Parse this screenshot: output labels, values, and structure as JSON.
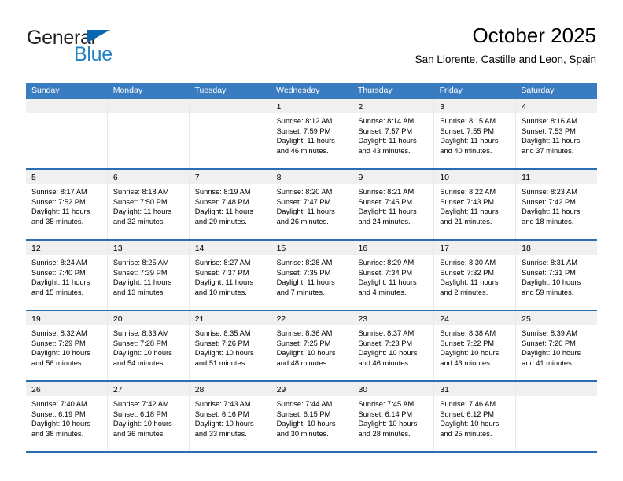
{
  "brand": {
    "name_dark": "General",
    "name_blue": "Blue",
    "color_dark": "#231f20",
    "color_blue": "#2081c8",
    "triangle_color": "#0b66b1"
  },
  "header": {
    "title": "October 2025",
    "subtitle": "San Llorente, Castille and Leon, Spain"
  },
  "theme": {
    "header_row_bg": "#3a7cc0",
    "week_separator": "#2c6cb0",
    "daynum_bg": "#f0f0f0",
    "text": "#000000"
  },
  "calendar": {
    "weekdays": [
      "Sunday",
      "Monday",
      "Tuesday",
      "Wednesday",
      "Thursday",
      "Friday",
      "Saturday"
    ],
    "weeks": [
      [
        {
          "day": "",
          "empty": true
        },
        {
          "day": "",
          "empty": true
        },
        {
          "day": "",
          "empty": true
        },
        {
          "day": "1",
          "sunrise": "Sunrise: 8:12 AM",
          "sunset": "Sunset: 7:59 PM",
          "daylight1": "Daylight: 11 hours",
          "daylight2": "and 46 minutes."
        },
        {
          "day": "2",
          "sunrise": "Sunrise: 8:14 AM",
          "sunset": "Sunset: 7:57 PM",
          "daylight1": "Daylight: 11 hours",
          "daylight2": "and 43 minutes."
        },
        {
          "day": "3",
          "sunrise": "Sunrise: 8:15 AM",
          "sunset": "Sunset: 7:55 PM",
          "daylight1": "Daylight: 11 hours",
          "daylight2": "and 40 minutes."
        },
        {
          "day": "4",
          "sunrise": "Sunrise: 8:16 AM",
          "sunset": "Sunset: 7:53 PM",
          "daylight1": "Daylight: 11 hours",
          "daylight2": "and 37 minutes."
        }
      ],
      [
        {
          "day": "5",
          "sunrise": "Sunrise: 8:17 AM",
          "sunset": "Sunset: 7:52 PM",
          "daylight1": "Daylight: 11 hours",
          "daylight2": "and 35 minutes."
        },
        {
          "day": "6",
          "sunrise": "Sunrise: 8:18 AM",
          "sunset": "Sunset: 7:50 PM",
          "daylight1": "Daylight: 11 hours",
          "daylight2": "and 32 minutes."
        },
        {
          "day": "7",
          "sunrise": "Sunrise: 8:19 AM",
          "sunset": "Sunset: 7:48 PM",
          "daylight1": "Daylight: 11 hours",
          "daylight2": "and 29 minutes."
        },
        {
          "day": "8",
          "sunrise": "Sunrise: 8:20 AM",
          "sunset": "Sunset: 7:47 PM",
          "daylight1": "Daylight: 11 hours",
          "daylight2": "and 26 minutes."
        },
        {
          "day": "9",
          "sunrise": "Sunrise: 8:21 AM",
          "sunset": "Sunset: 7:45 PM",
          "daylight1": "Daylight: 11 hours",
          "daylight2": "and 24 minutes."
        },
        {
          "day": "10",
          "sunrise": "Sunrise: 8:22 AM",
          "sunset": "Sunset: 7:43 PM",
          "daylight1": "Daylight: 11 hours",
          "daylight2": "and 21 minutes."
        },
        {
          "day": "11",
          "sunrise": "Sunrise: 8:23 AM",
          "sunset": "Sunset: 7:42 PM",
          "daylight1": "Daylight: 11 hours",
          "daylight2": "and 18 minutes."
        }
      ],
      [
        {
          "day": "12",
          "sunrise": "Sunrise: 8:24 AM",
          "sunset": "Sunset: 7:40 PM",
          "daylight1": "Daylight: 11 hours",
          "daylight2": "and 15 minutes."
        },
        {
          "day": "13",
          "sunrise": "Sunrise: 8:25 AM",
          "sunset": "Sunset: 7:39 PM",
          "daylight1": "Daylight: 11 hours",
          "daylight2": "and 13 minutes."
        },
        {
          "day": "14",
          "sunrise": "Sunrise: 8:27 AM",
          "sunset": "Sunset: 7:37 PM",
          "daylight1": "Daylight: 11 hours",
          "daylight2": "and 10 minutes."
        },
        {
          "day": "15",
          "sunrise": "Sunrise: 8:28 AM",
          "sunset": "Sunset: 7:35 PM",
          "daylight1": "Daylight: 11 hours",
          "daylight2": "and 7 minutes."
        },
        {
          "day": "16",
          "sunrise": "Sunrise: 8:29 AM",
          "sunset": "Sunset: 7:34 PM",
          "daylight1": "Daylight: 11 hours",
          "daylight2": "and 4 minutes."
        },
        {
          "day": "17",
          "sunrise": "Sunrise: 8:30 AM",
          "sunset": "Sunset: 7:32 PM",
          "daylight1": "Daylight: 11 hours",
          "daylight2": "and 2 minutes."
        },
        {
          "day": "18",
          "sunrise": "Sunrise: 8:31 AM",
          "sunset": "Sunset: 7:31 PM",
          "daylight1": "Daylight: 10 hours",
          "daylight2": "and 59 minutes."
        }
      ],
      [
        {
          "day": "19",
          "sunrise": "Sunrise: 8:32 AM",
          "sunset": "Sunset: 7:29 PM",
          "daylight1": "Daylight: 10 hours",
          "daylight2": "and 56 minutes."
        },
        {
          "day": "20",
          "sunrise": "Sunrise: 8:33 AM",
          "sunset": "Sunset: 7:28 PM",
          "daylight1": "Daylight: 10 hours",
          "daylight2": "and 54 minutes."
        },
        {
          "day": "21",
          "sunrise": "Sunrise: 8:35 AM",
          "sunset": "Sunset: 7:26 PM",
          "daylight1": "Daylight: 10 hours",
          "daylight2": "and 51 minutes."
        },
        {
          "day": "22",
          "sunrise": "Sunrise: 8:36 AM",
          "sunset": "Sunset: 7:25 PM",
          "daylight1": "Daylight: 10 hours",
          "daylight2": "and 48 minutes."
        },
        {
          "day": "23",
          "sunrise": "Sunrise: 8:37 AM",
          "sunset": "Sunset: 7:23 PM",
          "daylight1": "Daylight: 10 hours",
          "daylight2": "and 46 minutes."
        },
        {
          "day": "24",
          "sunrise": "Sunrise: 8:38 AM",
          "sunset": "Sunset: 7:22 PM",
          "daylight1": "Daylight: 10 hours",
          "daylight2": "and 43 minutes."
        },
        {
          "day": "25",
          "sunrise": "Sunrise: 8:39 AM",
          "sunset": "Sunset: 7:20 PM",
          "daylight1": "Daylight: 10 hours",
          "daylight2": "and 41 minutes."
        }
      ],
      [
        {
          "day": "26",
          "sunrise": "Sunrise: 7:40 AM",
          "sunset": "Sunset: 6:19 PM",
          "daylight1": "Daylight: 10 hours",
          "daylight2": "and 38 minutes."
        },
        {
          "day": "27",
          "sunrise": "Sunrise: 7:42 AM",
          "sunset": "Sunset: 6:18 PM",
          "daylight1": "Daylight: 10 hours",
          "daylight2": "and 36 minutes."
        },
        {
          "day": "28",
          "sunrise": "Sunrise: 7:43 AM",
          "sunset": "Sunset: 6:16 PM",
          "daylight1": "Daylight: 10 hours",
          "daylight2": "and 33 minutes."
        },
        {
          "day": "29",
          "sunrise": "Sunrise: 7:44 AM",
          "sunset": "Sunset: 6:15 PM",
          "daylight1": "Daylight: 10 hours",
          "daylight2": "and 30 minutes."
        },
        {
          "day": "30",
          "sunrise": "Sunrise: 7:45 AM",
          "sunset": "Sunset: 6:14 PM",
          "daylight1": "Daylight: 10 hours",
          "daylight2": "and 28 minutes."
        },
        {
          "day": "31",
          "sunrise": "Sunrise: 7:46 AM",
          "sunset": "Sunset: 6:12 PM",
          "daylight1": "Daylight: 10 hours",
          "daylight2": "and 25 minutes."
        },
        {
          "day": "",
          "empty": true
        }
      ]
    ]
  }
}
